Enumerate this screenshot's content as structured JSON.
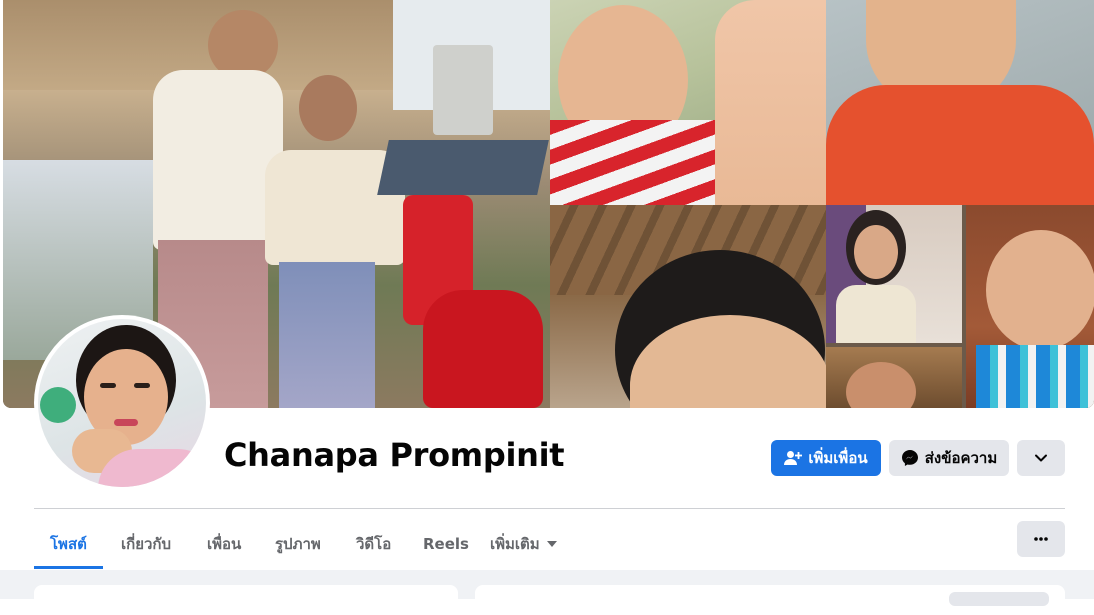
{
  "profile": {
    "name": "Chanapa Prompinit"
  },
  "actions": {
    "add_friend_label": "เพิ่มเพื่อน",
    "add_friend_icon": "person-add-icon",
    "message_label": "ส่งข้อความ",
    "message_icon": "messenger-icon",
    "more_icon": "chevron-down-icon"
  },
  "tabs": [
    {
      "label": "โพสต์",
      "active": true
    },
    {
      "label": "เกี่ยวกับ"
    },
    {
      "label": "เพื่อน"
    },
    {
      "label": "รูปภาพ"
    },
    {
      "label": "วิดีโอ"
    },
    {
      "label": "Reels"
    },
    {
      "label": "เพิ่มเติม",
      "icon": "caret-down-icon"
    }
  ],
  "tab_menu_icon": "ellipsis-icon",
  "colors": {
    "accent": "#1b74e4",
    "button_gray": "#e4e6eb",
    "text_secondary": "#65676b",
    "page_bg": "#f0f2f5"
  }
}
